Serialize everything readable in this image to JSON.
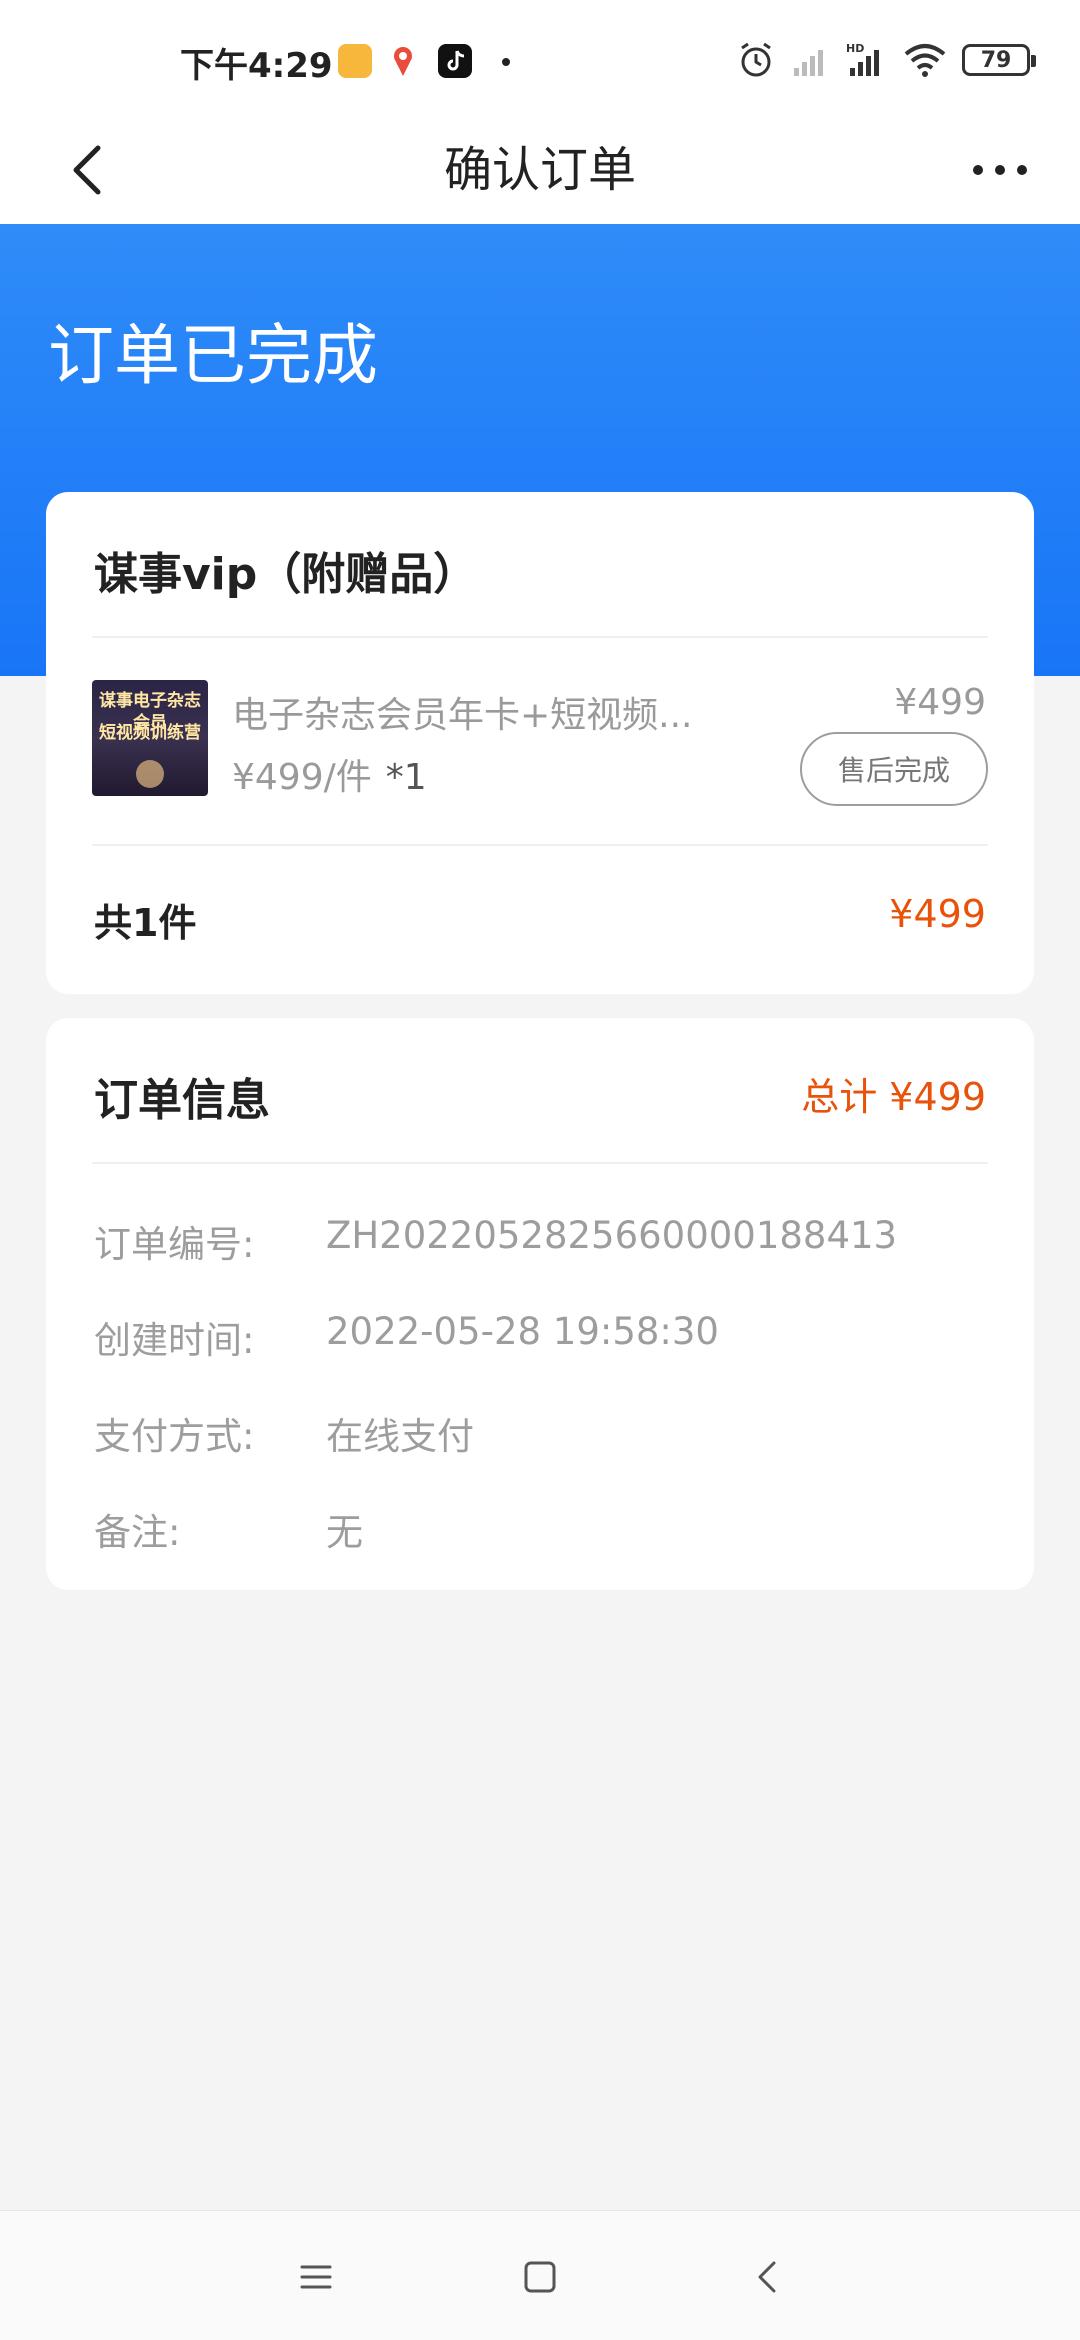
{
  "status_bar": {
    "time": "下午4:29",
    "battery": "79",
    "network": "HD"
  },
  "nav": {
    "title": "确认订单"
  },
  "hero": {
    "status": "订单已完成"
  },
  "product_card": {
    "title": "谋事vip（附赠品）",
    "thumb_line1": "谋事电子杂志会员",
    "thumb_line2": "短视频训练营",
    "product_name": "电子杂志会员年卡+短视频...",
    "unit_price": "¥499/件",
    "quantity": "*1",
    "price": "¥499",
    "after_sale_label": "售后完成",
    "total_count": "共1件",
    "total_amount": "¥499"
  },
  "order_card": {
    "title": "订单信息",
    "total": "总计 ¥499",
    "rows": [
      {
        "label": "订单编号:",
        "value": "ZH20220528256600001884​13"
      },
      {
        "label": "创建时间:",
        "value": "2022-05-28 19:58:30"
      },
      {
        "label": "支付方式:",
        "value": "在线支付"
      },
      {
        "label": "备注:",
        "value": "无"
      }
    ]
  },
  "colors": {
    "accent_blue": "#1875f7",
    "price_orange": "#e9520a"
  },
  "icons": [
    "back-arrow-icon",
    "more-icon",
    "alarm-icon",
    "signal-icon",
    "wifi-icon",
    "battery-icon",
    "menu-icon",
    "home-icon",
    "system-back-icon"
  ]
}
